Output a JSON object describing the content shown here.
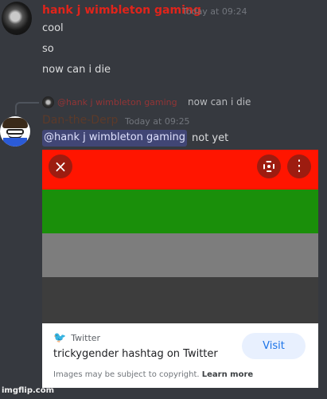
{
  "messages": {
    "hank": {
      "username": "hank j wimbleton gaming",
      "timestamp": "Today at 09:24",
      "lines": [
        "cool",
        "so",
        "now can i die"
      ]
    },
    "dan": {
      "reply_username": "@hank j wimbleton gaming",
      "reply_text": "now can i die",
      "username": "Dan-the-Derp",
      "timestamp": "Today at 09:25",
      "mention": "@hank j wimbleton gaming",
      "text": "not yet"
    }
  },
  "embed": {
    "close_icon": "×",
    "more_icon": "⋮",
    "source": "Twitter",
    "title": "trickygender hashtag on Twitter",
    "visit_label": "Visit",
    "copyright_text": "Images may be subject to copyright.",
    "learn_more": "Learn more"
  },
  "watermark": "imgflip.com",
  "colors": {
    "hank_name": "#e0241b",
    "background": "#36393f",
    "mention_bg": "#414675",
    "band_red": "#ff1500",
    "band_green": "#1a8f0a",
    "band_gray": "#7d7d7d",
    "band_dark": "#3d3d3d"
  }
}
